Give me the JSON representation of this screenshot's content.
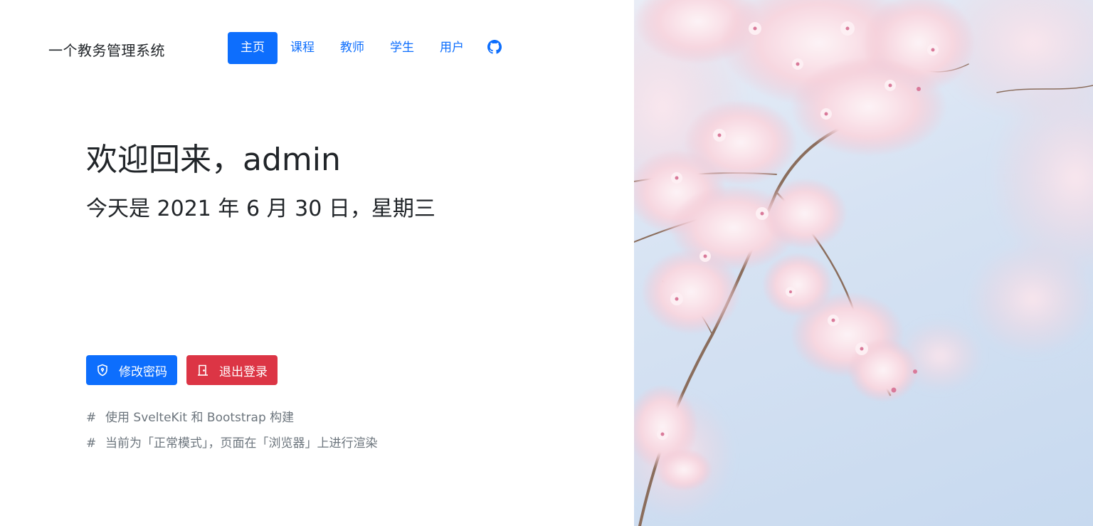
{
  "app": {
    "brand": "一个教务管理系统"
  },
  "nav": {
    "items": [
      {
        "label": "主页",
        "active": true
      },
      {
        "label": "课程",
        "active": false
      },
      {
        "label": "教师",
        "active": false
      },
      {
        "label": "学生",
        "active": false
      },
      {
        "label": "用户",
        "active": false
      }
    ],
    "github_icon": "github-icon"
  },
  "main": {
    "greeting": "欢迎回来，admin",
    "date_line": "今天是 2021 年 6 月 30 日，星期三",
    "buttons": {
      "change_password": "修改密码",
      "logout": "退出登录"
    },
    "notes": [
      {
        "hash": "#",
        "text": "使用 SvelteKit 和 Bootstrap 构建"
      },
      {
        "hash": "#",
        "text": "当前为「正常模式」，页面在「浏览器」上进行渲染"
      }
    ]
  },
  "colors": {
    "primary": "#0d6efd",
    "danger": "#dc3545",
    "muted": "#6c757d",
    "text": "#212529",
    "blossom": "#f6cfd9",
    "sky": "#cfdff1"
  }
}
